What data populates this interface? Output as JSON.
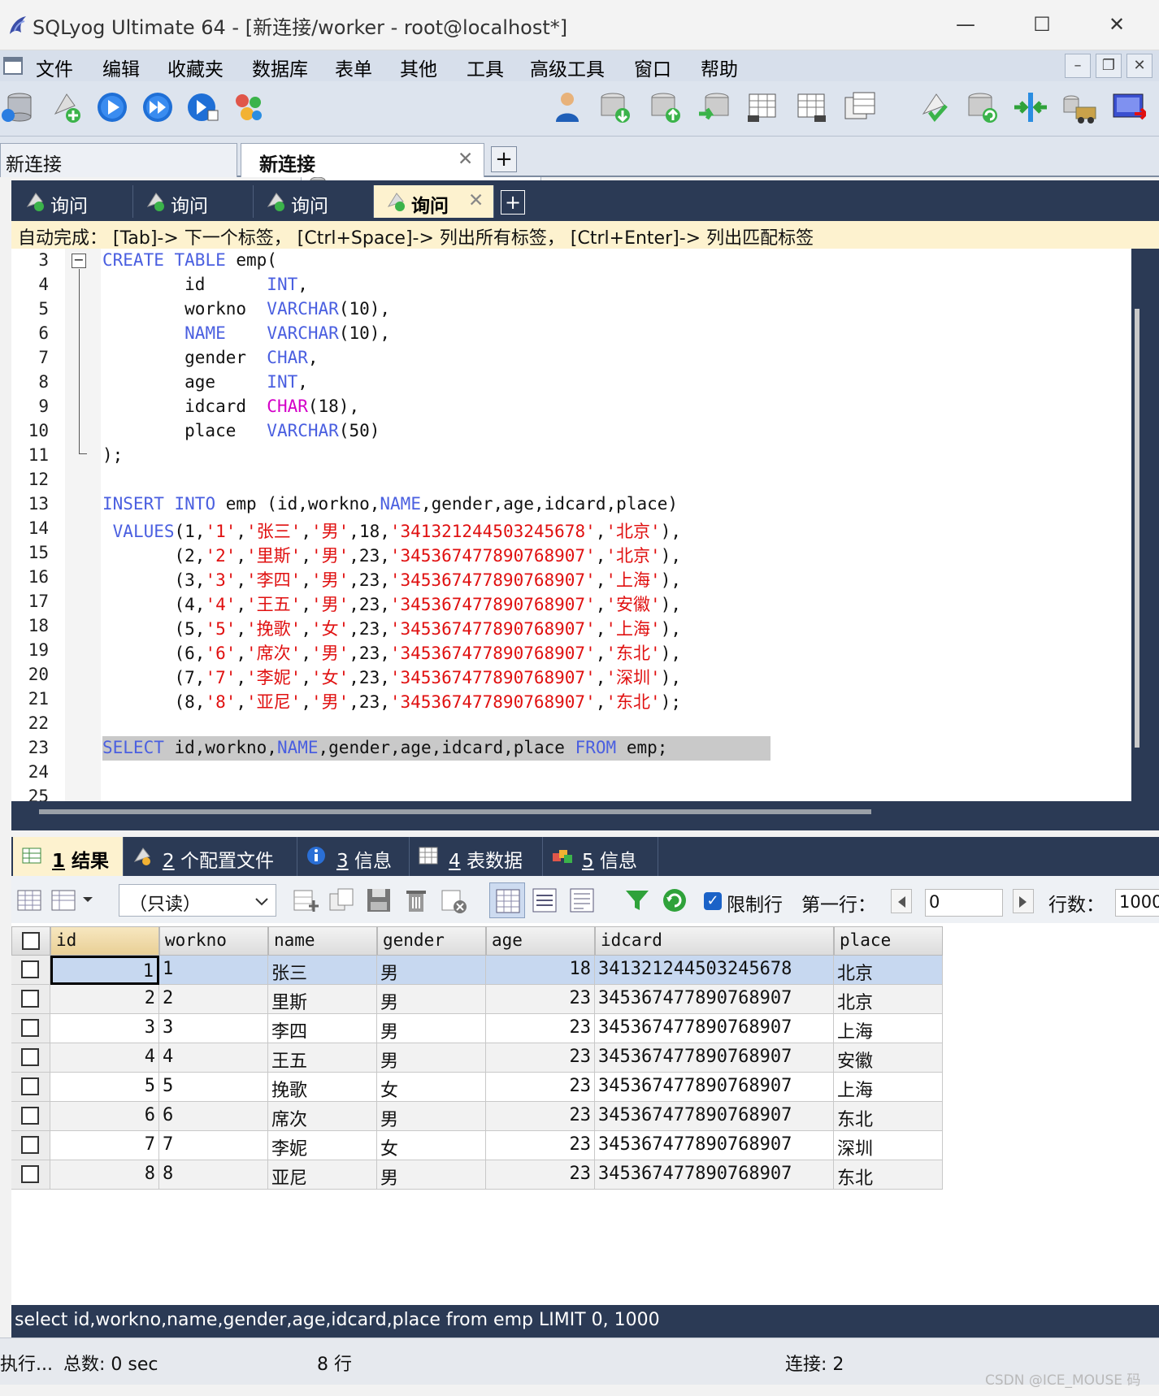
{
  "window": {
    "title": "SQLyog Ultimate 64 - [新连接/worker - root@localhost*]",
    "minimize": "—",
    "maximize": "☐",
    "close": "✕"
  },
  "menu": [
    "文件",
    "编辑",
    "收藏夹",
    "数据库",
    "表单",
    "其他",
    "工具",
    "高级工具",
    "窗口",
    "帮助"
  ],
  "toolbar": {
    "database": "worker"
  },
  "connection_tabs": [
    {
      "label": "新连接",
      "active": false
    },
    {
      "label": "新连接",
      "active": true,
      "close": "✕"
    }
  ],
  "connection_add": "+",
  "query_tabs": [
    {
      "label": "询问",
      "active": false
    },
    {
      "label": "询问",
      "active": false
    },
    {
      "label": "询问",
      "active": false
    },
    {
      "label": "询问",
      "active": true,
      "close": "✕"
    }
  ],
  "query_add": "+",
  "hint": "自动完成： [Tab]-> 下一个标签， [Ctrl+Space]-> 列出所有标签， [Ctrl+Enter]-> 列出匹配标签",
  "editor": {
    "lines": [
      {
        "n": "3",
        "html": "<span class=\"kw\">CREATE</span> <span class=\"kw\">TABLE</span> emp("
      },
      {
        "n": "4",
        "html": "        id      <span class=\"kw\">INT</span>,"
      },
      {
        "n": "5",
        "html": "        workno  <span class=\"kw\">VARCHAR</span>(10),"
      },
      {
        "n": "6",
        "html": "        <span class=\"kw\">NAME</span>    <span class=\"kw\">VARCHAR</span>(10),"
      },
      {
        "n": "7",
        "html": "        gender  <span class=\"kw\">CHAR</span>,"
      },
      {
        "n": "8",
        "html": "        age     <span class=\"kw\">INT</span>,"
      },
      {
        "n": "9",
        "html": "        idcard  <span class=\"mg\">CHAR</span>(18),"
      },
      {
        "n": "10",
        "html": "        place   <span class=\"kw\">VARCHAR</span>(50)"
      },
      {
        "n": "11",
        "html": ");"
      },
      {
        "n": "12",
        "html": ""
      },
      {
        "n": "13",
        "html": "<span class=\"kw\">INSERT</span> <span class=\"kw\">INTO</span> emp (id,workno,<span class=\"kw\">NAME</span>,gender,age,idcard,place)"
      },
      {
        "n": "14",
        "html": " <span class=\"kw\">VALUES</span>(1,<span class=\"str\">'1'</span>,<span class=\"str\">'张三'</span>,<span class=\"str\">'男'</span>,18,<span class=\"str\">'341321244503245678'</span>,<span class=\"str\">'北京'</span>),"
      },
      {
        "n": "15",
        "html": "       (2,<span class=\"str\">'2'</span>,<span class=\"str\">'里斯'</span>,<span class=\"str\">'男'</span>,23,<span class=\"str\">'345367477890768907'</span>,<span class=\"str\">'北京'</span>),"
      },
      {
        "n": "16",
        "html": "       (3,<span class=\"str\">'3'</span>,<span class=\"str\">'李四'</span>,<span class=\"str\">'男'</span>,23,<span class=\"str\">'345367477890768907'</span>,<span class=\"str\">'上海'</span>),"
      },
      {
        "n": "17",
        "html": "       (4,<span class=\"str\">'4'</span>,<span class=\"str\">'王五'</span>,<span class=\"str\">'男'</span>,23,<span class=\"str\">'345367477890768907'</span>,<span class=\"str\">'安徽'</span>),"
      },
      {
        "n": "18",
        "html": "       (5,<span class=\"str\">'5'</span>,<span class=\"str\">'挽歌'</span>,<span class=\"str\">'女'</span>,23,<span class=\"str\">'345367477890768907'</span>,<span class=\"str\">'上海'</span>),"
      },
      {
        "n": "19",
        "html": "       (6,<span class=\"str\">'6'</span>,<span class=\"str\">'席次'</span>,<span class=\"str\">'男'</span>,23,<span class=\"str\">'345367477890768907'</span>,<span class=\"str\">'东北'</span>),"
      },
      {
        "n": "20",
        "html": "       (7,<span class=\"str\">'7'</span>,<span class=\"str\">'李妮'</span>,<span class=\"str\">'女'</span>,23,<span class=\"str\">'345367477890768907'</span>,<span class=\"str\">'深圳'</span>),"
      },
      {
        "n": "21",
        "html": "       (8,<span class=\"str\">'8'</span>,<span class=\"str\">'亚尼'</span>,<span class=\"str\">'男'</span>,23,<span class=\"str\">'345367477890768907'</span>,<span class=\"str\">'东北'</span>);"
      },
      {
        "n": "22",
        "html": ""
      },
      {
        "n": "23",
        "html": "<span class=\"kw\">SELECT</span> id,workno,<span class=\"kw\">NAME</span>,gender,age,idcard,place <span class=\"kw\">FROM</span> emp;"
      },
      {
        "n": "24",
        "html": ""
      },
      {
        "n": "25",
        "html": ""
      }
    ]
  },
  "result_tabs": [
    {
      "num": "1",
      "label": "结果",
      "active": true
    },
    {
      "num": "2",
      "label": "个配置文件",
      "active": false
    },
    {
      "num": "3",
      "label": "信息",
      "active": false
    },
    {
      "num": "4",
      "label": "表数据",
      "active": false
    },
    {
      "num": "5",
      "label": "信息",
      "active": false
    }
  ],
  "result_toolbar": {
    "mode": "（只读）",
    "limit_label": "限制行",
    "first_row_label": "第一行：",
    "first_row_value": "0",
    "rows_label": "行数：",
    "rows_value": "1000"
  },
  "grid": {
    "columns": [
      "id",
      "workno",
      "name",
      "gender",
      "age",
      "idcard",
      "place"
    ],
    "rows": [
      [
        "1",
        "1",
        "张三",
        "男",
        "18",
        "341321244503245678",
        "北京"
      ],
      [
        "2",
        "2",
        "里斯",
        "男",
        "23",
        "345367477890768907",
        "北京"
      ],
      [
        "3",
        "3",
        "李四",
        "男",
        "23",
        "345367477890768907",
        "上海"
      ],
      [
        "4",
        "4",
        "王五",
        "男",
        "23",
        "345367477890768907",
        "安徽"
      ],
      [
        "5",
        "5",
        "挽歌",
        "女",
        "23",
        "345367477890768907",
        "上海"
      ],
      [
        "6",
        "6",
        "席次",
        "男",
        "23",
        "345367477890768907",
        "东北"
      ],
      [
        "7",
        "7",
        "李妮",
        "女",
        "23",
        "345367477890768907",
        "深圳"
      ],
      [
        "8",
        "8",
        "亚尼",
        "男",
        "23",
        "345367477890768907",
        "东北"
      ]
    ]
  },
  "sql_status": "select id,workno,name,gender,age,idcard,place from emp LIMIT 0, 1000",
  "status": {
    "exec": "执行...",
    "total": "总数: 0 sec",
    "rows": "8 行",
    "conn": "连接: 2"
  },
  "watermark": "CSDN @ICE_MOUSE 码",
  "colors": {
    "keyword": "#4a5fe0",
    "string": "#e01010",
    "tab_bg": "#2b3a55",
    "selected_row": "#c7d8f0"
  }
}
